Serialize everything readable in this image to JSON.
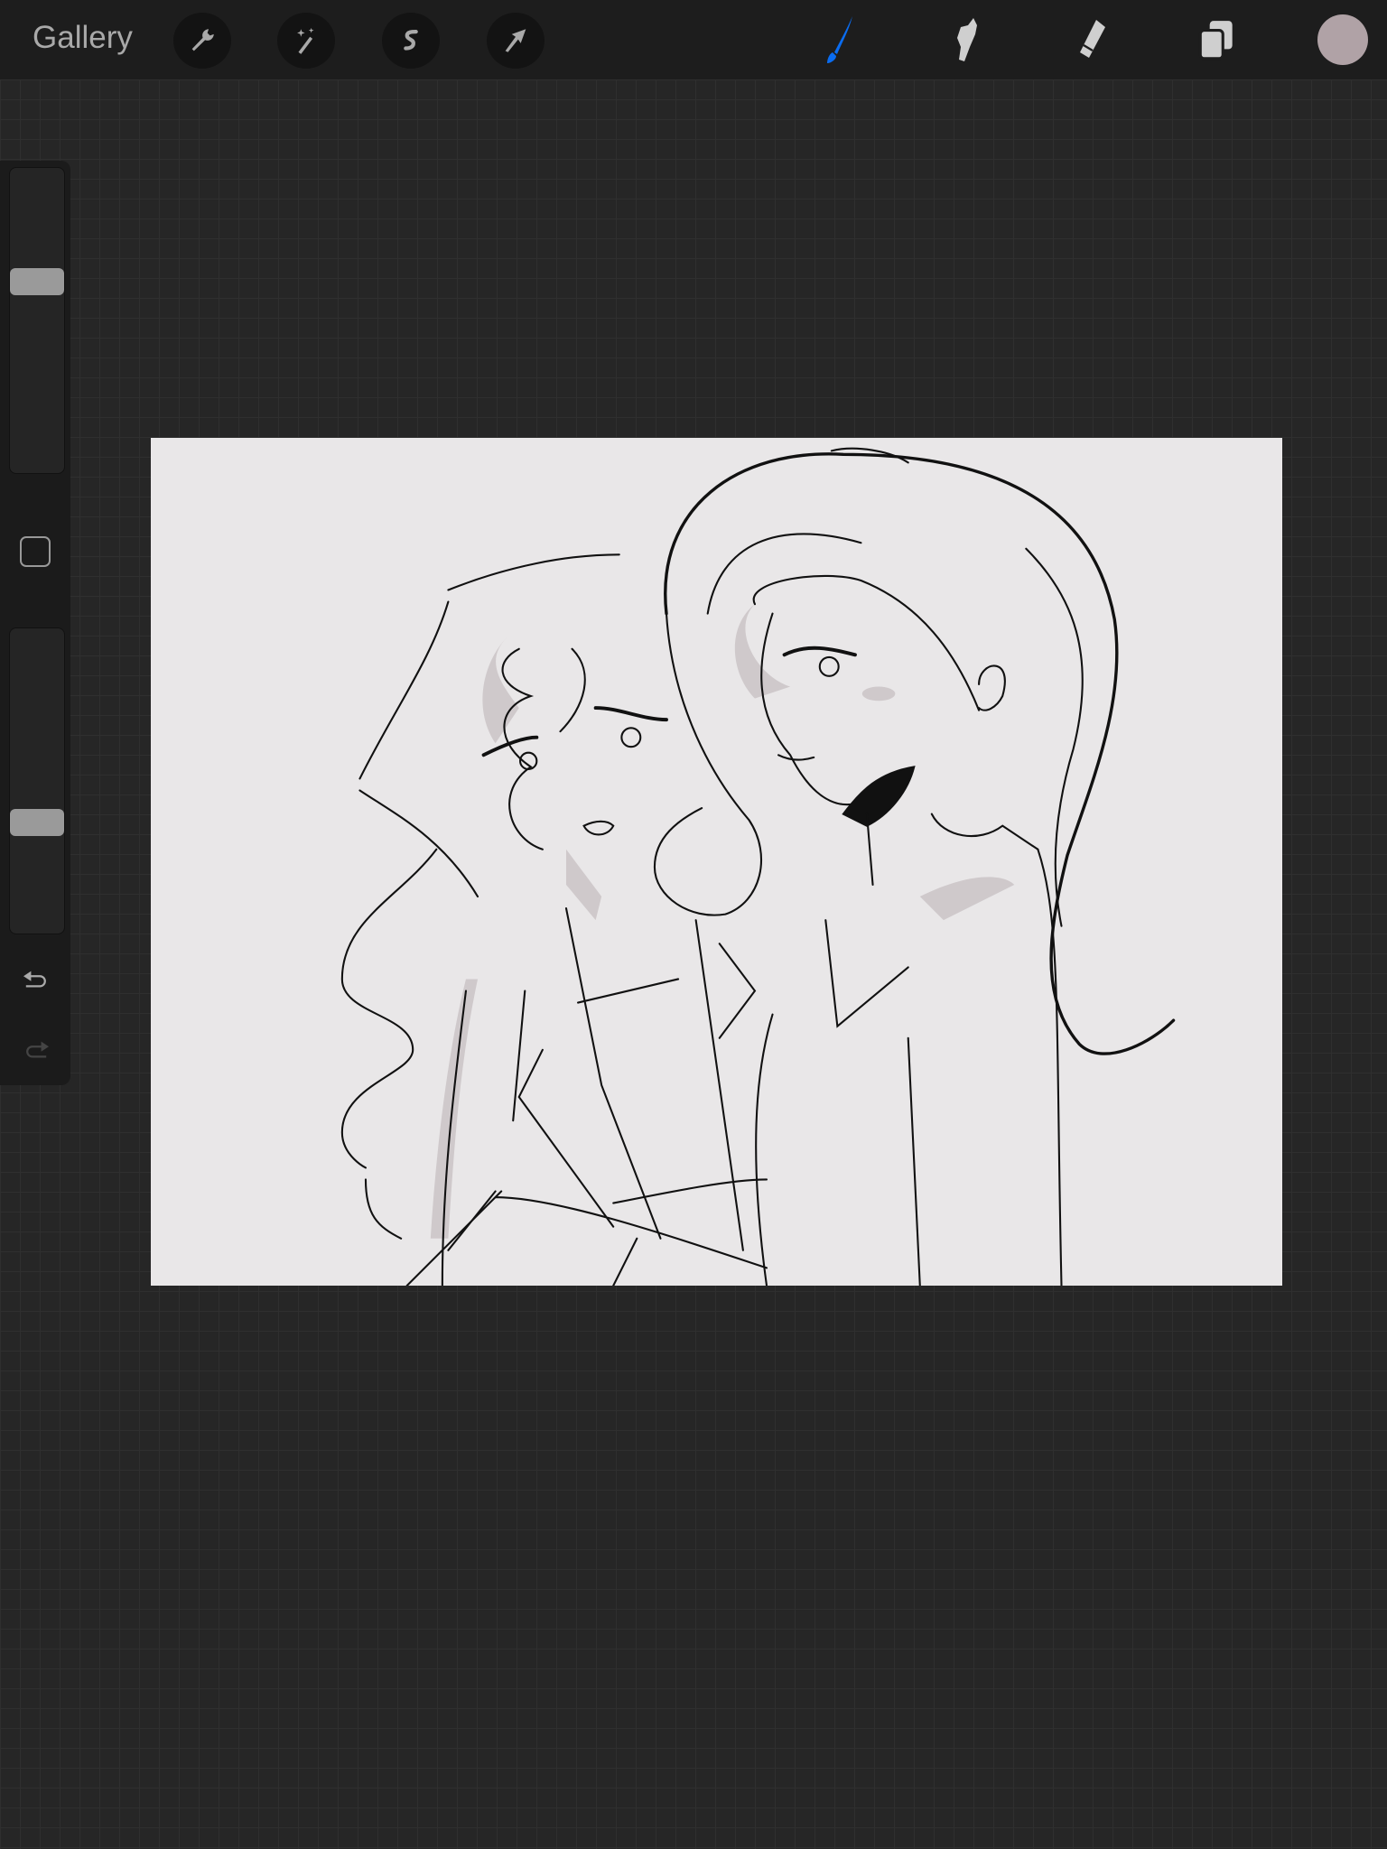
{
  "topbar": {
    "gallery_label": "Gallery",
    "left_tools": [
      "wrench-icon",
      "magic-wand-icon",
      "selection-s-icon",
      "move-arrow-icon"
    ],
    "right_tools": [
      "brush-icon",
      "smudge-icon",
      "eraser-icon",
      "layers-icon"
    ],
    "active_tool": "brush",
    "accent_color": "#0a6cf0",
    "current_color": "#b0a2a6"
  },
  "sidebar": {
    "brush_size_fraction": 0.63,
    "opacity_fraction": 0.37
  }
}
